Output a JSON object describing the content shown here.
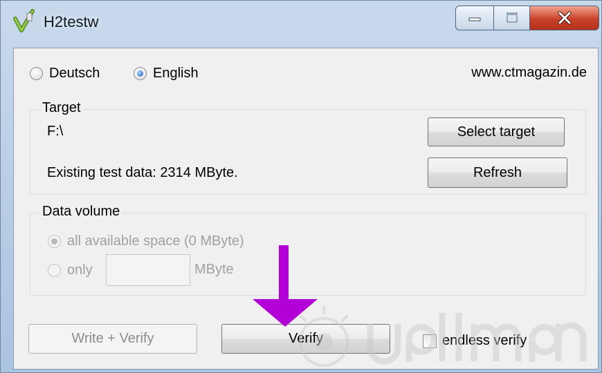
{
  "window": {
    "title": "H2testw"
  },
  "language": {
    "options": [
      {
        "label": "Deutsch",
        "checked": false
      },
      {
        "label": "English",
        "checked": true
      }
    ],
    "website": "www.ctmagazin.de"
  },
  "target": {
    "group_label": "Target",
    "path": "F:\\",
    "existing_data": "Existing test data: 2314 MByte.",
    "select_button": "Select target",
    "refresh_button": "Refresh"
  },
  "volume": {
    "group_label": "Data volume",
    "all_label": "all available space (0 MByte)",
    "only_label": "only",
    "amount_value": "",
    "unit": "MByte",
    "enabled": false
  },
  "actions": {
    "write_verify": "Write + Verify",
    "verify": "Verify",
    "endless_verify": "endless verify",
    "endless_checked": false
  },
  "colors": {
    "annotation_arrow": "#b300d6",
    "close_button": "#c9412a"
  },
  "icons": [
    "h2testw-app-icon",
    "minimize-icon",
    "maximize-icon",
    "close-icon"
  ]
}
